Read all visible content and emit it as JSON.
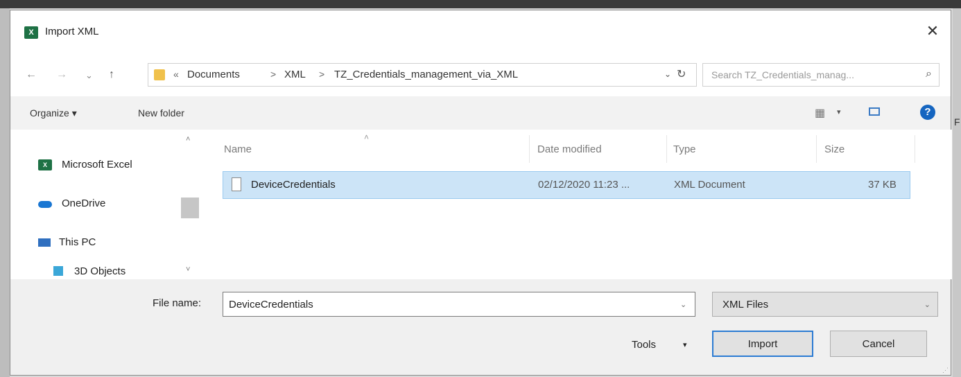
{
  "window": {
    "title": "Import XML",
    "app_icon": "X",
    "close": "✕"
  },
  "nav": {
    "back": "←",
    "forward": "→",
    "recent": "⌄",
    "up": "↑",
    "breadcrumb_prefix": "«",
    "breadcrumb": [
      "Documents",
      "XML",
      "TZ_Credentials_management_via_XML"
    ],
    "breadcrumb_separator": ">",
    "address_dropdown": "⌄",
    "refresh": "↻"
  },
  "search": {
    "placeholder": "Search TZ_Credentials_manag...",
    "icon": "⌕"
  },
  "toolbar": {
    "organize": "Organize ▾",
    "new_folder": "New folder",
    "view_dropdown": "▾",
    "help": "?"
  },
  "sidebar": {
    "items": [
      {
        "label": "Microsoft Excel",
        "icon": "excel-icon"
      },
      {
        "label": "OneDrive",
        "icon": "cloud-icon"
      },
      {
        "label": "This PC",
        "icon": "computer-icon"
      },
      {
        "label": "3D Objects",
        "icon": "3d-objects-icon"
      }
    ],
    "scroll_up": "˄",
    "scroll_down": "˅"
  },
  "filelist": {
    "sort_arrow": "˄",
    "columns": [
      "Name",
      "Date modified",
      "Type",
      "Size"
    ],
    "rows": [
      {
        "name": "DeviceCredentials",
        "date": "02/12/2020 11:23 ...",
        "type": "XML Document",
        "size": "37 KB"
      }
    ]
  },
  "footer": {
    "file_name_label": "File name:",
    "file_name_value": "DeviceCredentials",
    "file_name_dropdown": "⌄",
    "file_type": "XML Files",
    "file_type_dropdown": "⌄",
    "tools": "Tools",
    "tools_arrow": "▾",
    "import": "Import",
    "cancel": "Cancel",
    "grip": "⋰"
  },
  "background": {
    "right_edge_text": "F"
  },
  "colors": {
    "selection": "#cce4f7",
    "selection_border": "#99c9ef",
    "accent": "#2b7bd3",
    "excel_green": "#1e7145"
  }
}
